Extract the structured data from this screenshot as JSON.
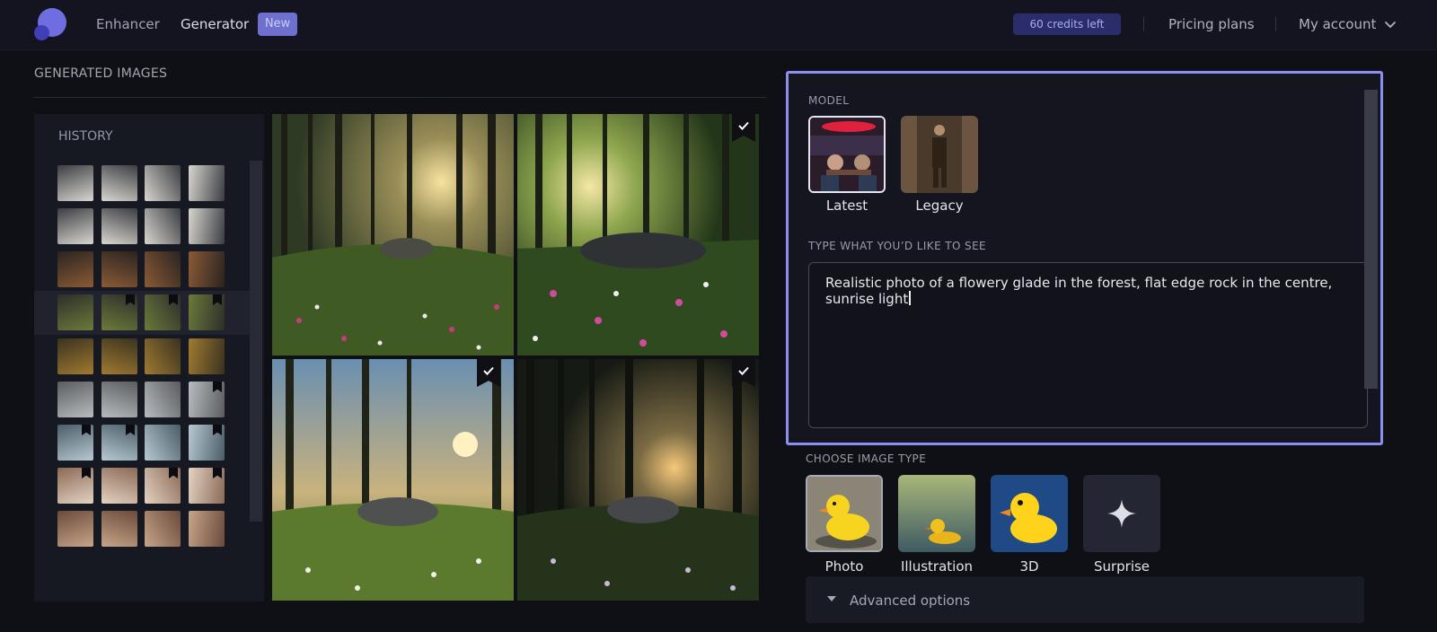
{
  "header": {
    "logo": "app-logo",
    "nav": {
      "enhancer": "Enhancer",
      "generator": "Generator",
      "new_badge": "New"
    },
    "credits": "60 credits left",
    "pricing": "Pricing plans",
    "account": "My account"
  },
  "left": {
    "section_title": "GENERATED IMAGES",
    "history_title": "HISTORY"
  },
  "right": {
    "model_label": "MODEL",
    "models": [
      {
        "label": "Latest",
        "selected": true
      },
      {
        "label": "Legacy",
        "selected": false
      }
    ],
    "prompt_label": "TYPE WHAT YOU’D LIKE TO SEE",
    "prompt_value_line1": "Realistic photo of a flowery glade in the forest, flat edge rock in the centre,",
    "prompt_value_line2": "sunrise light",
    "type_label": "CHOOSE IMAGE TYPE",
    "types": [
      {
        "label": "Photo",
        "selected": true
      },
      {
        "label": "Illustration",
        "selected": false
      },
      {
        "label": "3D",
        "selected": false
      },
      {
        "label": "Surprise",
        "selected": false
      }
    ],
    "advanced": "Advanced options"
  },
  "colors": {
    "accent": "#8d8ff0",
    "background": "#0f1016",
    "badge": "#6d70cf"
  }
}
